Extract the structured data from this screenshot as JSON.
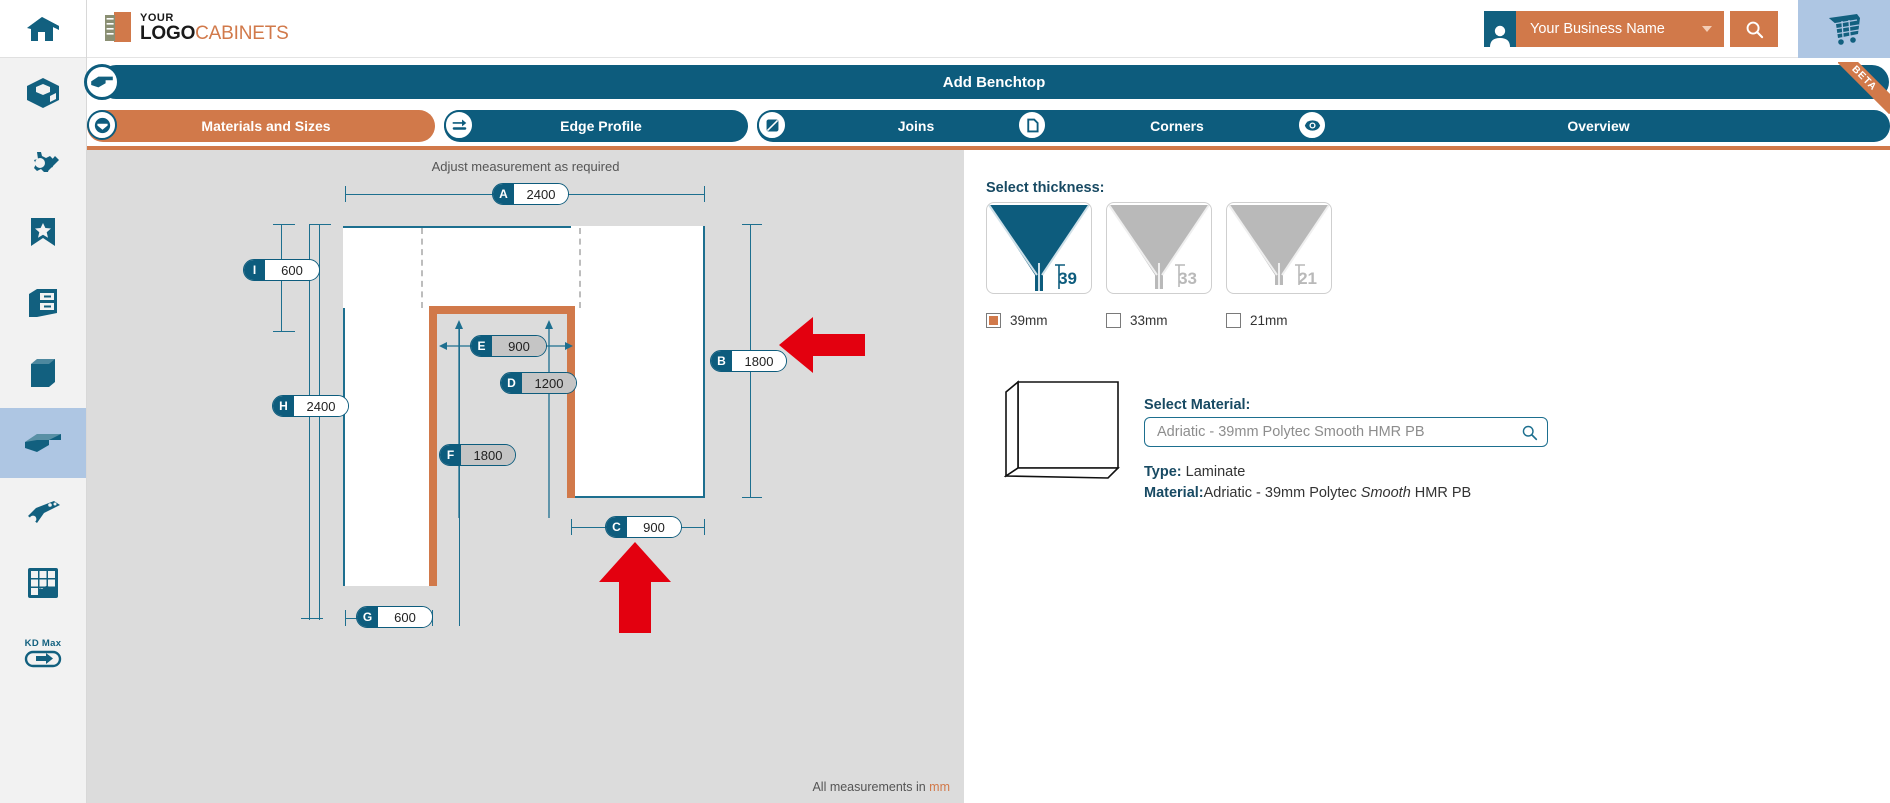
{
  "rail": {
    "items": [
      {
        "name": "home-icon",
        "label": "Home"
      },
      {
        "name": "room-icon",
        "label": "Room"
      },
      {
        "name": "settings-edit-icon",
        "label": "Design Settings"
      },
      {
        "name": "favourites-icon",
        "label": "Favourites"
      },
      {
        "name": "cabinet-icon",
        "label": "Cabinets"
      },
      {
        "name": "panel-icon",
        "label": "Panels"
      },
      {
        "name": "benchtop-icon",
        "label": "Benchtops"
      },
      {
        "name": "hinge-hardware-icon",
        "label": "Hardware"
      },
      {
        "name": "keypad-icon",
        "label": "Keypad"
      },
      {
        "name": "kdmax-icon",
        "label": "KD Max"
      }
    ],
    "active_index": 6,
    "kdmax_label": "KD Max"
  },
  "header": {
    "logo_line1": "YOUR",
    "logo_line2": "LOGO",
    "logo_suffix": "CABINETS",
    "business_name": "Your Business Name",
    "search_icon": "search-icon",
    "cart_icon": "cart-icon",
    "avatar_icon": "user-avatar-icon"
  },
  "titlebar": {
    "title": "Add Benchtop",
    "beta": "BETA",
    "icon": "benchtop-icon"
  },
  "tabs": [
    {
      "label": "Materials and Sizes",
      "active": true,
      "icon": "benchtop-round-icon"
    },
    {
      "label": "Edge Profile",
      "active": false,
      "icon": "edge-profile-icon"
    },
    {
      "label": "Joins",
      "active": false,
      "icon": "joins-icon"
    },
    {
      "label": "Corners",
      "active": false,
      "icon": "corners-icon"
    },
    {
      "label": "Overview",
      "active": false,
      "icon": "eye-icon"
    }
  ],
  "canvas": {
    "adjust_note": "Adjust measurement as required",
    "footer_note_prefix": "All measurements in ",
    "footer_note_unit": "mm",
    "measurements": [
      {
        "key": "A",
        "value": "2400",
        "style": "white"
      },
      {
        "key": "I",
        "value": "600",
        "style": "white"
      },
      {
        "key": "H",
        "value": "2400",
        "style": "white"
      },
      {
        "key": "B",
        "value": "1800",
        "style": "white"
      },
      {
        "key": "C",
        "value": "900",
        "style": "white"
      },
      {
        "key": "G",
        "value": "600",
        "style": "white"
      },
      {
        "key": "E",
        "value": "900",
        "style": "grey"
      },
      {
        "key": "D",
        "value": "1200",
        "style": "grey"
      },
      {
        "key": "F",
        "value": "1800",
        "style": "grey"
      }
    ],
    "annotations": [
      {
        "name": "red-arrow-left-pointing",
        "target": "B"
      },
      {
        "name": "red-arrow-up-pointing",
        "target": "C"
      }
    ]
  },
  "right": {
    "thickness_title": "Select thickness:",
    "thickness_options": [
      {
        "value": "39",
        "label": "39mm",
        "selected": true
      },
      {
        "value": "33",
        "label": "33mm",
        "selected": false
      },
      {
        "value": "21",
        "label": "21mm",
        "selected": false
      }
    ],
    "material_title": "Select Material:",
    "material_placeholder": "Adriatic - 39mm Polytec Smooth HMR PB",
    "material_search_icon": "search-icon",
    "type_key": "Type:",
    "type_value": "Laminate",
    "material_key": "Material:",
    "material_value_a": "Adriatic - 39mm Polytec ",
    "material_value_em": "Smooth",
    "material_value_b": " HMR PB"
  },
  "colors": {
    "brand_blue": "#0d5c7d",
    "brand_orange": "#d1794a",
    "rail_active": "#aec6e3",
    "canvas_bg": "#dcdcdc",
    "annotation_red": "#e3000f"
  }
}
